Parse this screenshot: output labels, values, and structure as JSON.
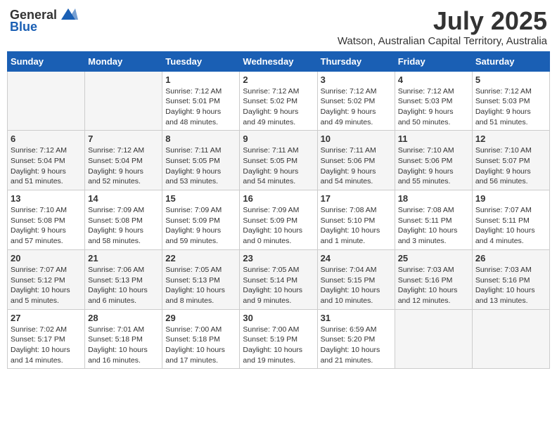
{
  "header": {
    "logo_general": "General",
    "logo_blue": "Blue",
    "month_title": "July 2025",
    "location": "Watson, Australian Capital Territory, Australia"
  },
  "days_of_week": [
    "Sunday",
    "Monday",
    "Tuesday",
    "Wednesday",
    "Thursday",
    "Friday",
    "Saturday"
  ],
  "weeks": [
    [
      {
        "day": "",
        "info": ""
      },
      {
        "day": "",
        "info": ""
      },
      {
        "day": "1",
        "info": "Sunrise: 7:12 AM\nSunset: 5:01 PM\nDaylight: 9 hours\nand 48 minutes."
      },
      {
        "day": "2",
        "info": "Sunrise: 7:12 AM\nSunset: 5:02 PM\nDaylight: 9 hours\nand 49 minutes."
      },
      {
        "day": "3",
        "info": "Sunrise: 7:12 AM\nSunset: 5:02 PM\nDaylight: 9 hours\nand 49 minutes."
      },
      {
        "day": "4",
        "info": "Sunrise: 7:12 AM\nSunset: 5:03 PM\nDaylight: 9 hours\nand 50 minutes."
      },
      {
        "day": "5",
        "info": "Sunrise: 7:12 AM\nSunset: 5:03 PM\nDaylight: 9 hours\nand 51 minutes."
      }
    ],
    [
      {
        "day": "6",
        "info": "Sunrise: 7:12 AM\nSunset: 5:04 PM\nDaylight: 9 hours\nand 51 minutes."
      },
      {
        "day": "7",
        "info": "Sunrise: 7:12 AM\nSunset: 5:04 PM\nDaylight: 9 hours\nand 52 minutes."
      },
      {
        "day": "8",
        "info": "Sunrise: 7:11 AM\nSunset: 5:05 PM\nDaylight: 9 hours\nand 53 minutes."
      },
      {
        "day": "9",
        "info": "Sunrise: 7:11 AM\nSunset: 5:05 PM\nDaylight: 9 hours\nand 54 minutes."
      },
      {
        "day": "10",
        "info": "Sunrise: 7:11 AM\nSunset: 5:06 PM\nDaylight: 9 hours\nand 54 minutes."
      },
      {
        "day": "11",
        "info": "Sunrise: 7:10 AM\nSunset: 5:06 PM\nDaylight: 9 hours\nand 55 minutes."
      },
      {
        "day": "12",
        "info": "Sunrise: 7:10 AM\nSunset: 5:07 PM\nDaylight: 9 hours\nand 56 minutes."
      }
    ],
    [
      {
        "day": "13",
        "info": "Sunrise: 7:10 AM\nSunset: 5:08 PM\nDaylight: 9 hours\nand 57 minutes."
      },
      {
        "day": "14",
        "info": "Sunrise: 7:09 AM\nSunset: 5:08 PM\nDaylight: 9 hours\nand 58 minutes."
      },
      {
        "day": "15",
        "info": "Sunrise: 7:09 AM\nSunset: 5:09 PM\nDaylight: 9 hours\nand 59 minutes."
      },
      {
        "day": "16",
        "info": "Sunrise: 7:09 AM\nSunset: 5:09 PM\nDaylight: 10 hours\nand 0 minutes."
      },
      {
        "day": "17",
        "info": "Sunrise: 7:08 AM\nSunset: 5:10 PM\nDaylight: 10 hours\nand 1 minute."
      },
      {
        "day": "18",
        "info": "Sunrise: 7:08 AM\nSunset: 5:11 PM\nDaylight: 10 hours\nand 3 minutes."
      },
      {
        "day": "19",
        "info": "Sunrise: 7:07 AM\nSunset: 5:11 PM\nDaylight: 10 hours\nand 4 minutes."
      }
    ],
    [
      {
        "day": "20",
        "info": "Sunrise: 7:07 AM\nSunset: 5:12 PM\nDaylight: 10 hours\nand 5 minutes."
      },
      {
        "day": "21",
        "info": "Sunrise: 7:06 AM\nSunset: 5:13 PM\nDaylight: 10 hours\nand 6 minutes."
      },
      {
        "day": "22",
        "info": "Sunrise: 7:05 AM\nSunset: 5:13 PM\nDaylight: 10 hours\nand 8 minutes."
      },
      {
        "day": "23",
        "info": "Sunrise: 7:05 AM\nSunset: 5:14 PM\nDaylight: 10 hours\nand 9 minutes."
      },
      {
        "day": "24",
        "info": "Sunrise: 7:04 AM\nSunset: 5:15 PM\nDaylight: 10 hours\nand 10 minutes."
      },
      {
        "day": "25",
        "info": "Sunrise: 7:03 AM\nSunset: 5:16 PM\nDaylight: 10 hours\nand 12 minutes."
      },
      {
        "day": "26",
        "info": "Sunrise: 7:03 AM\nSunset: 5:16 PM\nDaylight: 10 hours\nand 13 minutes."
      }
    ],
    [
      {
        "day": "27",
        "info": "Sunrise: 7:02 AM\nSunset: 5:17 PM\nDaylight: 10 hours\nand 14 minutes."
      },
      {
        "day": "28",
        "info": "Sunrise: 7:01 AM\nSunset: 5:18 PM\nDaylight: 10 hours\nand 16 minutes."
      },
      {
        "day": "29",
        "info": "Sunrise: 7:00 AM\nSunset: 5:18 PM\nDaylight: 10 hours\nand 17 minutes."
      },
      {
        "day": "30",
        "info": "Sunrise: 7:00 AM\nSunset: 5:19 PM\nDaylight: 10 hours\nand 19 minutes."
      },
      {
        "day": "31",
        "info": "Sunrise: 6:59 AM\nSunset: 5:20 PM\nDaylight: 10 hours\nand 21 minutes."
      },
      {
        "day": "",
        "info": ""
      },
      {
        "day": "",
        "info": ""
      }
    ]
  ]
}
